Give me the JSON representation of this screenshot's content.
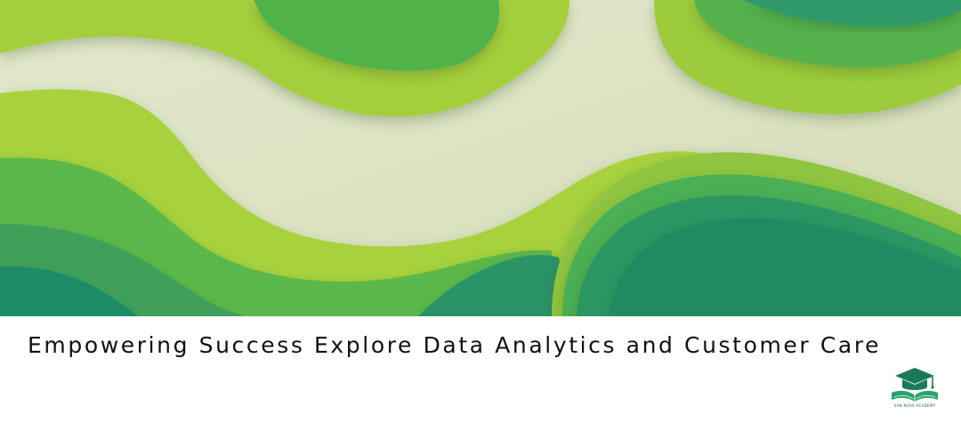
{
  "banner": {
    "headline": "Empowering Success Explore Data Analytics and Customer Care",
    "logo_text": "SAN NOVA ACADEMY",
    "logo_icon": "graduation-cap-book-icon"
  },
  "colors": {
    "background_cream": "#dfe5c4",
    "lime": "#a6d23b",
    "light_green": "#5cb74a",
    "mid_green": "#3fa55a",
    "teal_green": "#1f8e66",
    "logo_green": "#1a7a55",
    "text": "#111111"
  }
}
